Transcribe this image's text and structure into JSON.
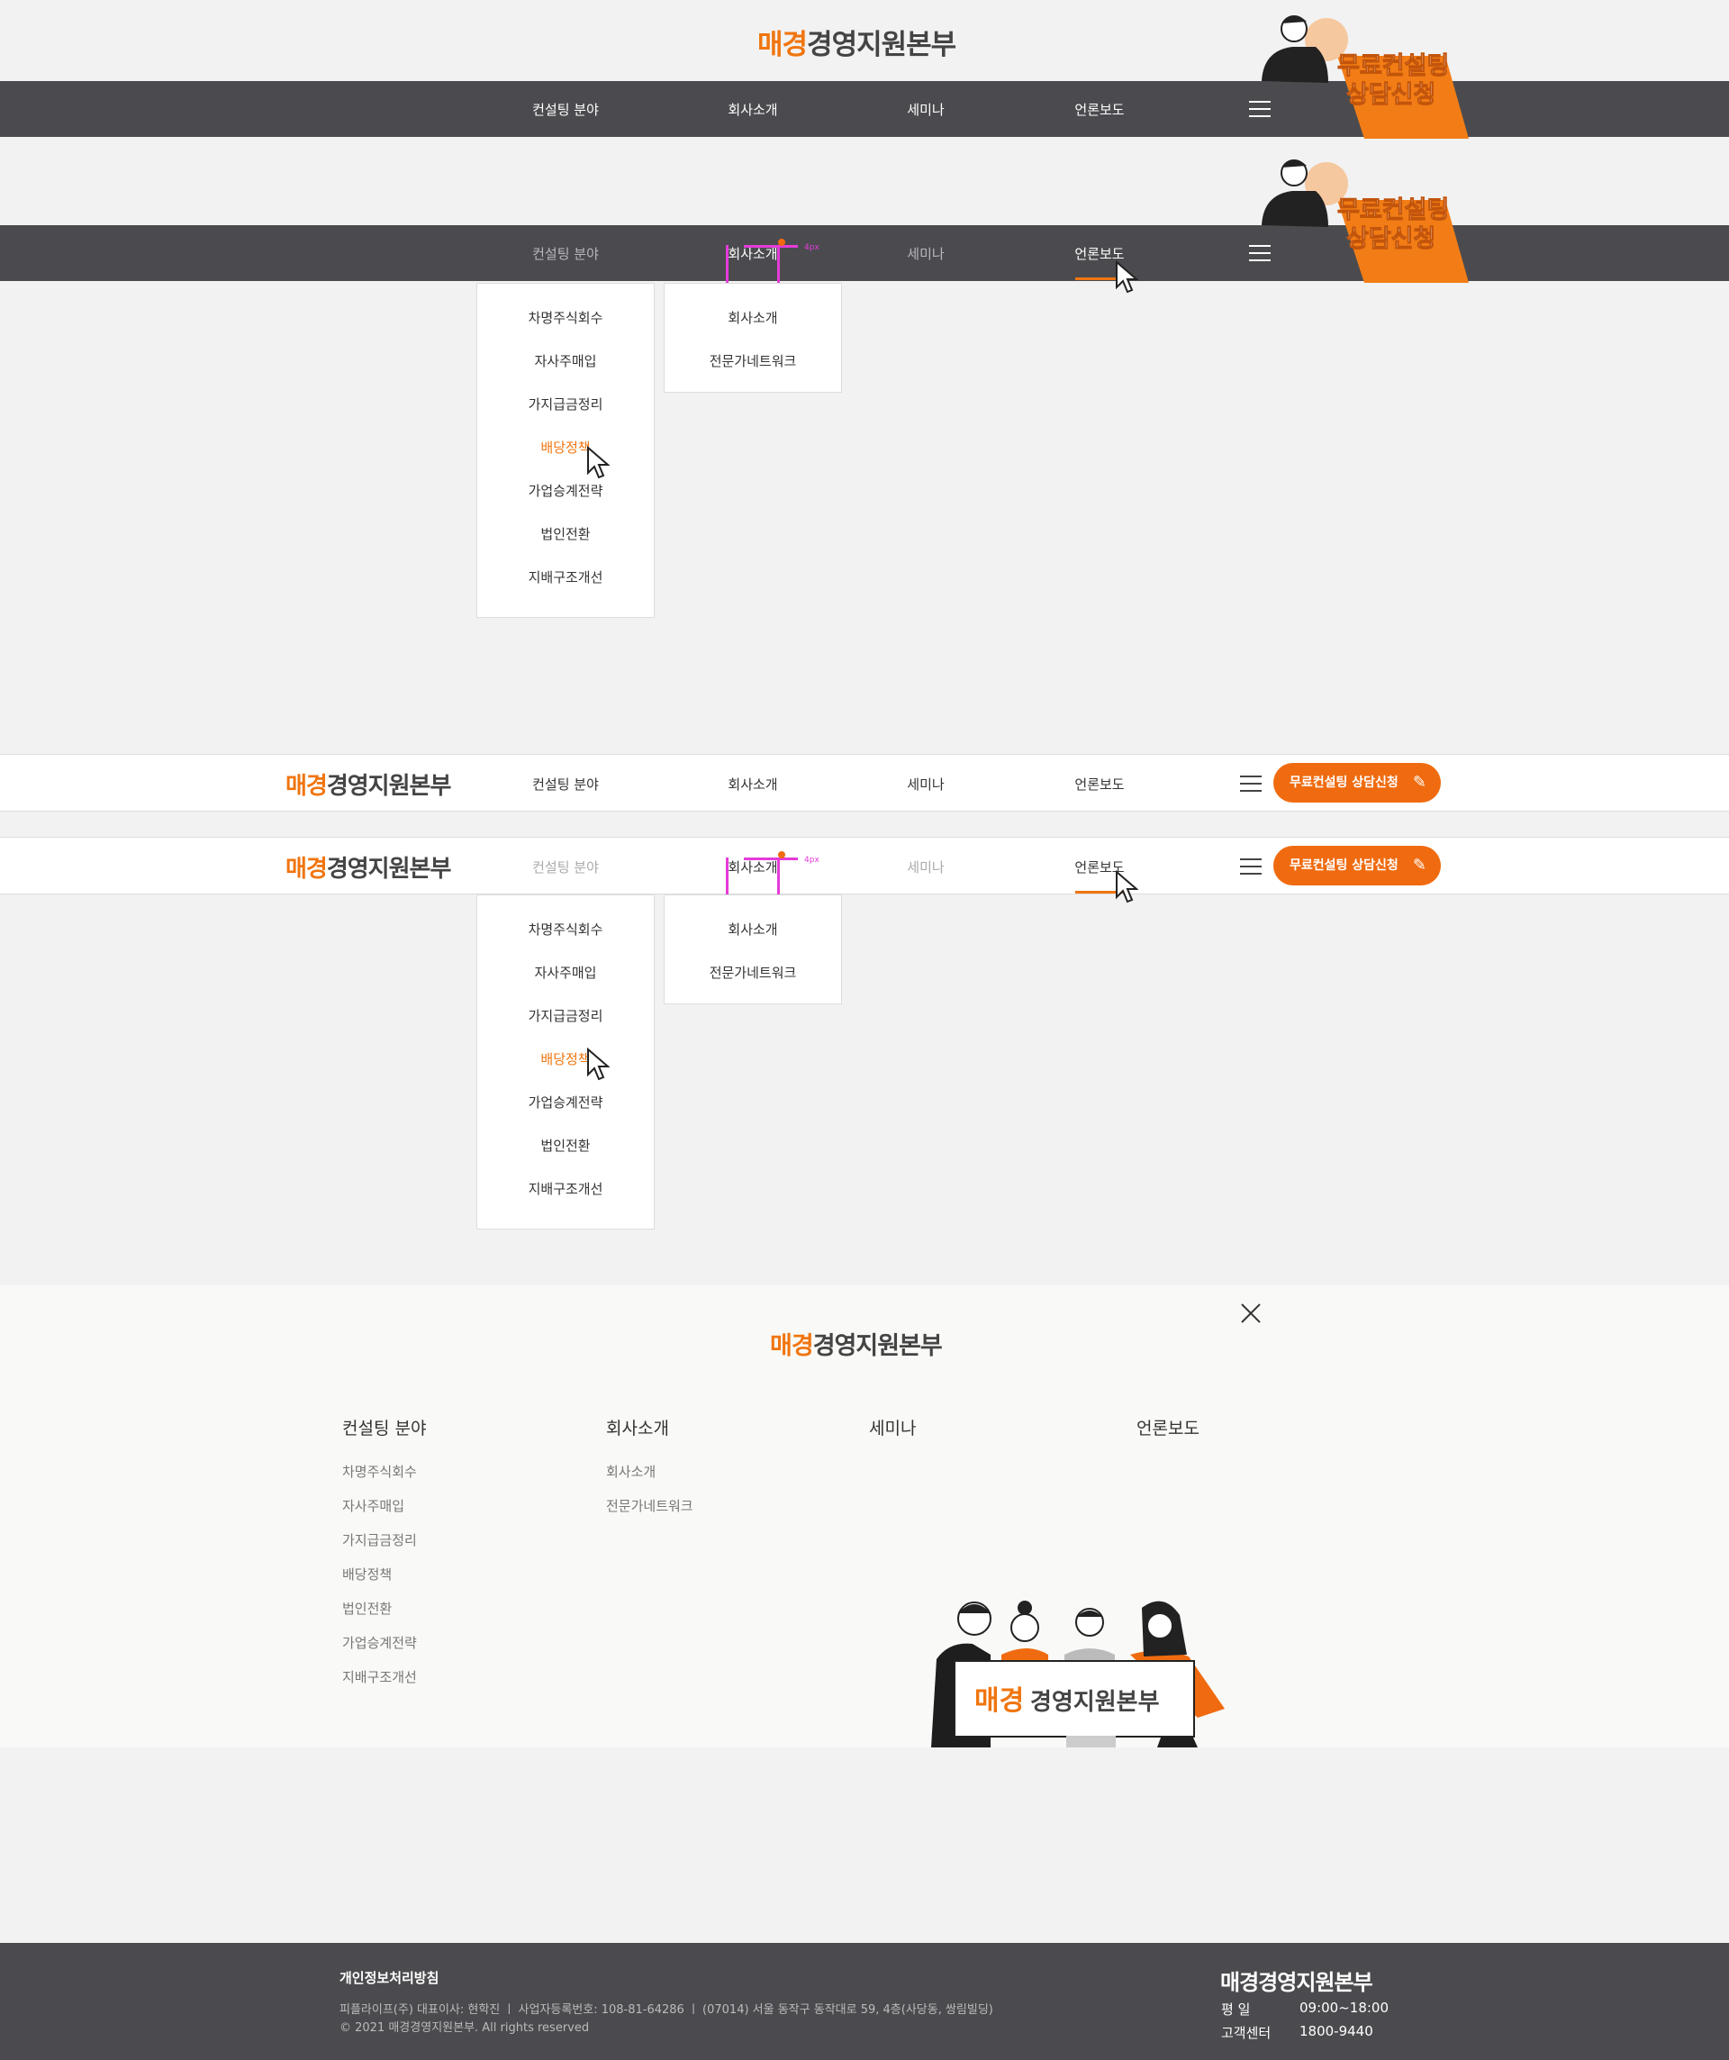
{
  "brand": {
    "accent": "매경",
    "rest": "경영지원본부",
    "accent_color": "#f0750f",
    "dark_bar_color": "#4b4b4f"
  },
  "nav": [
    "컨설팅 분야",
    "회사소개",
    "세미나",
    "언론보도"
  ],
  "banner": {
    "line1": "무료컨설팅",
    "line2": "상담신청"
  },
  "cta_pill": "무료컨설팅 상담신청",
  "menu_consulting": [
    "차명주식회수",
    "자사주매입",
    "가지급금정리",
    "배당정책",
    "가업승계전략",
    "법인전환",
    "지배구조개선"
  ],
  "menu_company": [
    "회사소개",
    "전문가네트워크"
  ],
  "guide_label": "4px",
  "sitemap": {
    "heads": [
      "컨설팅 분야",
      "회사소개",
      "세미나",
      "언론보도"
    ],
    "consulting": [
      "차명주식회수",
      "자사주매입",
      "가지급금정리",
      "배당정책",
      "법인전환",
      "가업승계전략",
      "지배구조개선"
    ],
    "company": [
      "회사소개",
      "전문가네트워크"
    ]
  },
  "footer": {
    "policy": "개인정보처리방침",
    "info": "피플라이프(주) 대표이사: 현학진 ㅣ 사업자등록번호: 108-81-64286 ㅣ (07014) 서울 동작구 동작대로 59, 4층(사당동, 쌍림빌딩)",
    "copyright": "© 2021 매경경영지원본부. All rights reserved",
    "hours_label": "평 일",
    "hours": "09:00~18:00",
    "center_label": "고객센터",
    "phone": "1800-9440"
  }
}
